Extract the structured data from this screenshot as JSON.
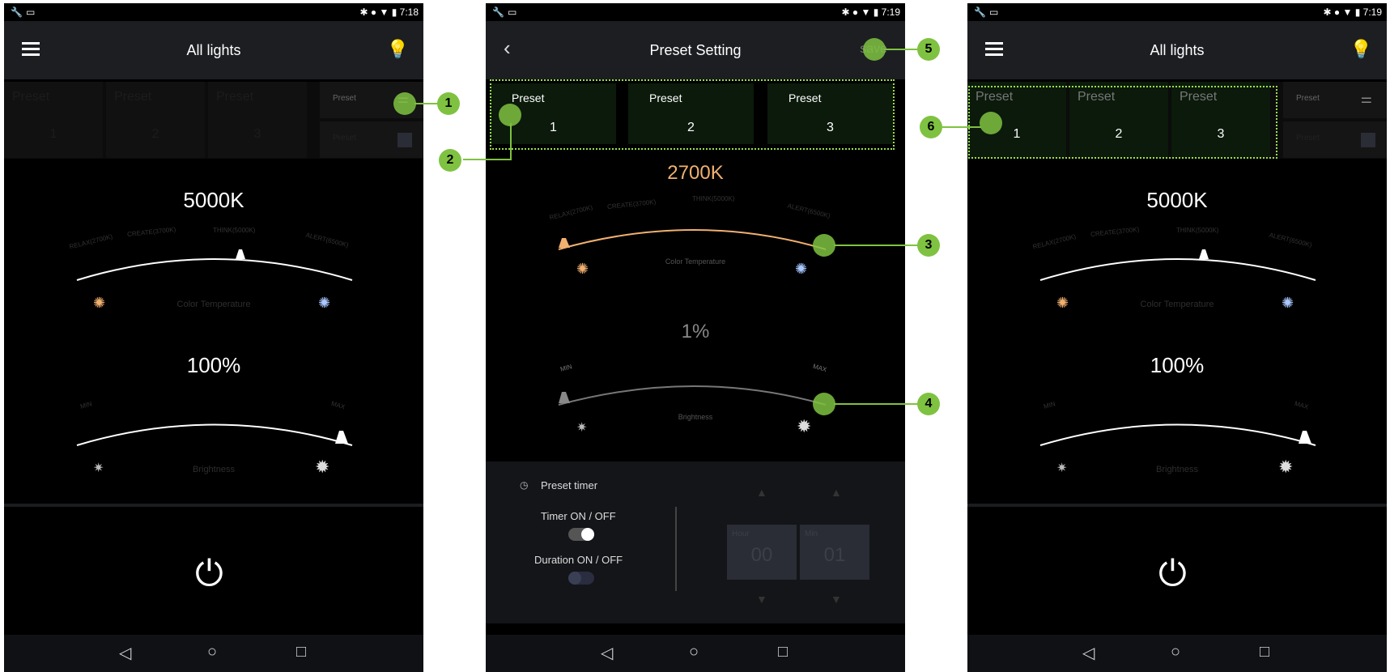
{
  "screen1": {
    "status_time": "7:18",
    "title": "All lights",
    "presets": [
      {
        "label": "Preset",
        "number": "1"
      },
      {
        "label": "Preset",
        "number": "2"
      },
      {
        "label": "Preset",
        "number": "3"
      }
    ],
    "side_preset_label": "Preset",
    "side_second_label": "Preset",
    "color_temp_value": "5000K",
    "ct_marks": [
      "RELAX(2700K)",
      "CREATE(3700K)",
      "THINK(5000K)",
      "ALERT(6500K)"
    ],
    "color_temp_label": "Color Temperature",
    "brightness_value": "100%",
    "min_label": "MIN",
    "max_label": "MAX",
    "brightness_label": "Brightness"
  },
  "screen2": {
    "status_time": "7:19",
    "title": "Preset Setting",
    "save_label": "save",
    "presets": [
      {
        "label": "Preset",
        "number": "1"
      },
      {
        "label": "Preset",
        "number": "2"
      },
      {
        "label": "Preset",
        "number": "3"
      }
    ],
    "color_temp_value": "2700K",
    "ct_marks": [
      "RELAX(2700K)",
      "CREATE(3700K)",
      "THINK(5000K)",
      "ALERT(6500K)"
    ],
    "color_temp_label": "Color Temperature",
    "brightness_value": "1%",
    "min_label": "MIN",
    "max_label": "MAX",
    "brightness_label": "Brightness",
    "timer_title": "Preset timer",
    "timer_on_off": "Timer ON / OFF",
    "duration_on_off": "Duration ON / OFF",
    "hour_label": "Hour",
    "min_small_label": "Min",
    "hour_value": "00",
    "min_value": "01"
  },
  "screen3": {
    "status_time": "7:19",
    "title": "All lights",
    "presets": [
      {
        "label": "Preset",
        "number": "1"
      },
      {
        "label": "Preset",
        "number": "2"
      },
      {
        "label": "Preset",
        "number": "3"
      }
    ],
    "side_preset_label": "Preset",
    "side_second_label": "Preset",
    "color_temp_value": "5000K",
    "ct_marks": [
      "RELAX(2700K)",
      "CREATE(3700K)",
      "THINK(5000K)",
      "ALERT(6500K)"
    ],
    "color_temp_label": "Color Temperature",
    "brightness_value": "100%",
    "min_label": "MIN",
    "max_label": "MAX",
    "brightness_label": "Brightness"
  },
  "annotations": [
    "1",
    "2",
    "3",
    "4",
    "5",
    "6"
  ],
  "colors": {
    "accent_green": "#7fc241",
    "selected_preset": "#2b7f84",
    "warm": "#f0b070",
    "cool": "#aac8ff"
  }
}
